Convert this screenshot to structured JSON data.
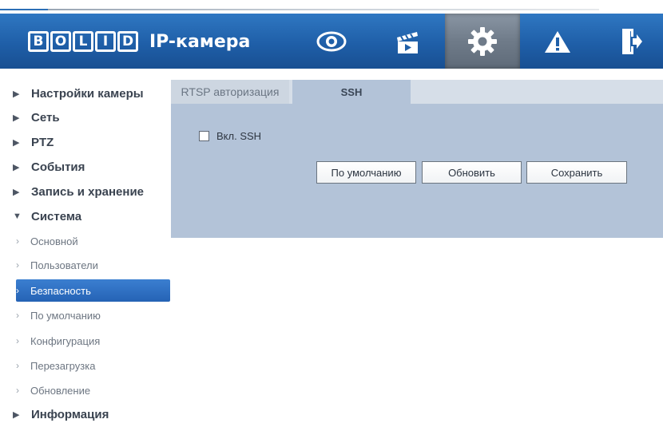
{
  "header": {
    "logo_letters": [
      "B",
      "O",
      "L",
      "I",
      "D"
    ],
    "product_title": "IP-камера",
    "nav": [
      {
        "icon": "eye-icon",
        "label": ""
      },
      {
        "icon": "clapperboard-icon",
        "label": ""
      },
      {
        "icon": "gear-icon",
        "label": ""
      },
      {
        "icon": "warning-icon",
        "label": ""
      },
      {
        "icon": "logout-icon",
        "label": ""
      }
    ]
  },
  "sidebar": {
    "sections": [
      {
        "label": "Настройки камеры",
        "expanded": false
      },
      {
        "label": "Сеть",
        "expanded": false
      },
      {
        "label": "PTZ",
        "expanded": false
      },
      {
        "label": "События",
        "expanded": false
      },
      {
        "label": "Запись и хранение",
        "expanded": false
      },
      {
        "label": "Система",
        "expanded": true
      }
    ],
    "system_items": [
      {
        "label": "Основной"
      },
      {
        "label": "Пользователи"
      },
      {
        "label": "Безпасность",
        "active": true
      },
      {
        "label": "По умолчанию"
      },
      {
        "label": "Конфигурация"
      },
      {
        "label": "Перезагрузка"
      },
      {
        "label": "Обновление"
      }
    ],
    "info_section": {
      "label": "Информация"
    }
  },
  "panel": {
    "tabs": [
      {
        "label": "RTSP авторизация",
        "active": false
      },
      {
        "label": "SSH",
        "active": true
      }
    ],
    "ssh_checkbox_label": "Вкл. SSH",
    "ssh_checked": false,
    "buttons": {
      "default_label": "По умолчанию",
      "refresh_label": "Обновить",
      "save_label": "Сохранить"
    }
  },
  "colors": {
    "header_blue": "#1f5fa8",
    "active_nav": "#6f7b89",
    "panel_bg": "#b3c3d8",
    "sidebar_active": "#2563b5"
  }
}
